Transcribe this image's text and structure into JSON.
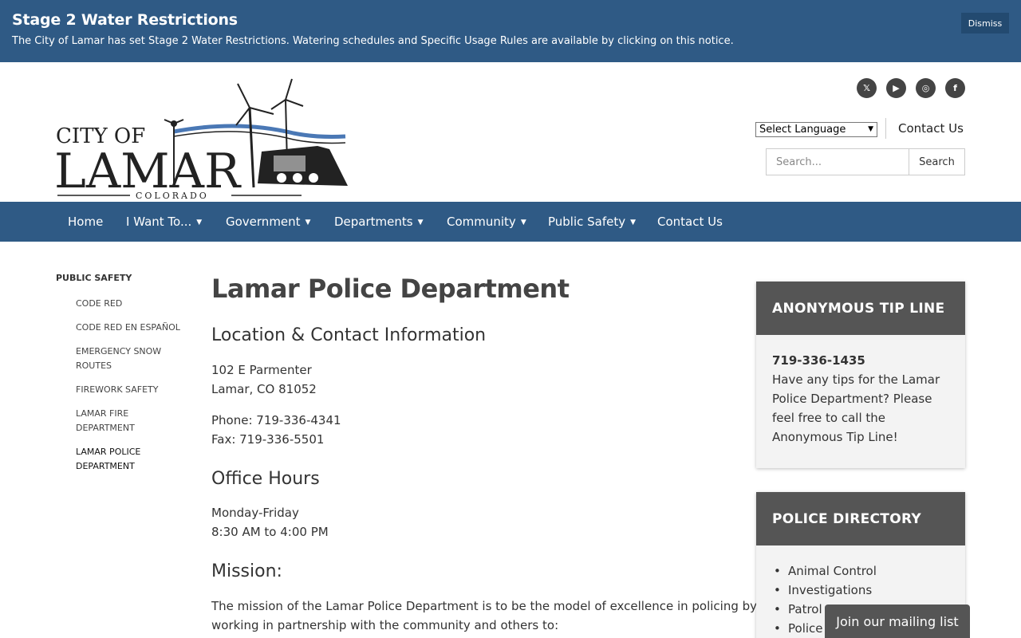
{
  "alert": {
    "title": "Stage 2 Water Restrictions",
    "text": "The City of Lamar has set Stage 2 Water Restrictions. Watering schedules and Specific Usage Rules are available by clicking on this notice.",
    "dismiss": "Dismiss"
  },
  "logo": {
    "line1": "CITY OF",
    "line2": "LAMAR",
    "line3": "COLORADO"
  },
  "social": [
    {
      "icon": "x-icon",
      "glyph": "𝕏"
    },
    {
      "icon": "youtube-icon",
      "glyph": "▶"
    },
    {
      "icon": "instagram-icon",
      "glyph": "◎"
    },
    {
      "icon": "facebook-icon",
      "glyph": "f"
    }
  ],
  "header": {
    "language_select": "Select Language",
    "contact": "Contact Us",
    "search_placeholder": "Search...",
    "search_button": "Search"
  },
  "nav": [
    {
      "label": "Home",
      "dropdown": false
    },
    {
      "label": "I Want To...",
      "dropdown": true
    },
    {
      "label": "Government",
      "dropdown": true
    },
    {
      "label": "Departments",
      "dropdown": true
    },
    {
      "label": "Community",
      "dropdown": true
    },
    {
      "label": "Public Safety",
      "dropdown": true
    },
    {
      "label": "Contact Us",
      "dropdown": false
    }
  ],
  "sidebar": {
    "heading": "PUBLIC SAFETY",
    "items": [
      "CODE RED",
      "CODE RED EN ESPAÑOL",
      "EMERGENCY SNOW ROUTES",
      "FIREWORK SAFETY",
      "LAMAR FIRE DEPARTMENT",
      "LAMAR POLICE DEPARTMENT"
    ]
  },
  "main": {
    "title": "Lamar Police Department",
    "location_heading": "Location & Contact Information",
    "address_line1": "102 E Parmenter",
    "address_line2": "Lamar, CO  81052",
    "phone": "Phone:  719-336-4341",
    "fax": "Fax:  719-336-5501",
    "hours_heading": "Office Hours",
    "hours_days": "Monday-Friday",
    "hours_time": "8:30 AM to 4:00 PM",
    "mission_heading": "Mission:",
    "mission_line1": "The mission of the Lamar Police Department is to be the model of excellence in policing by",
    "mission_line2": "working in partnership with the community and others to:"
  },
  "tip_box": {
    "heading": "ANONYMOUS TIP LINE",
    "phone": "719-336-1435",
    "text": "Have any tips for the Lamar Police Department? Please feel free to call the Anonymous Tip Line!"
  },
  "directory_box": {
    "heading": "POLICE DIRECTORY",
    "items": [
      "Animal Control",
      "Investigations",
      "Patrol",
      "Police"
    ]
  },
  "mailing": "Join our mailing list",
  "colors": {
    "brand_blue": "#2f5a85",
    "box_header": "#555555"
  }
}
